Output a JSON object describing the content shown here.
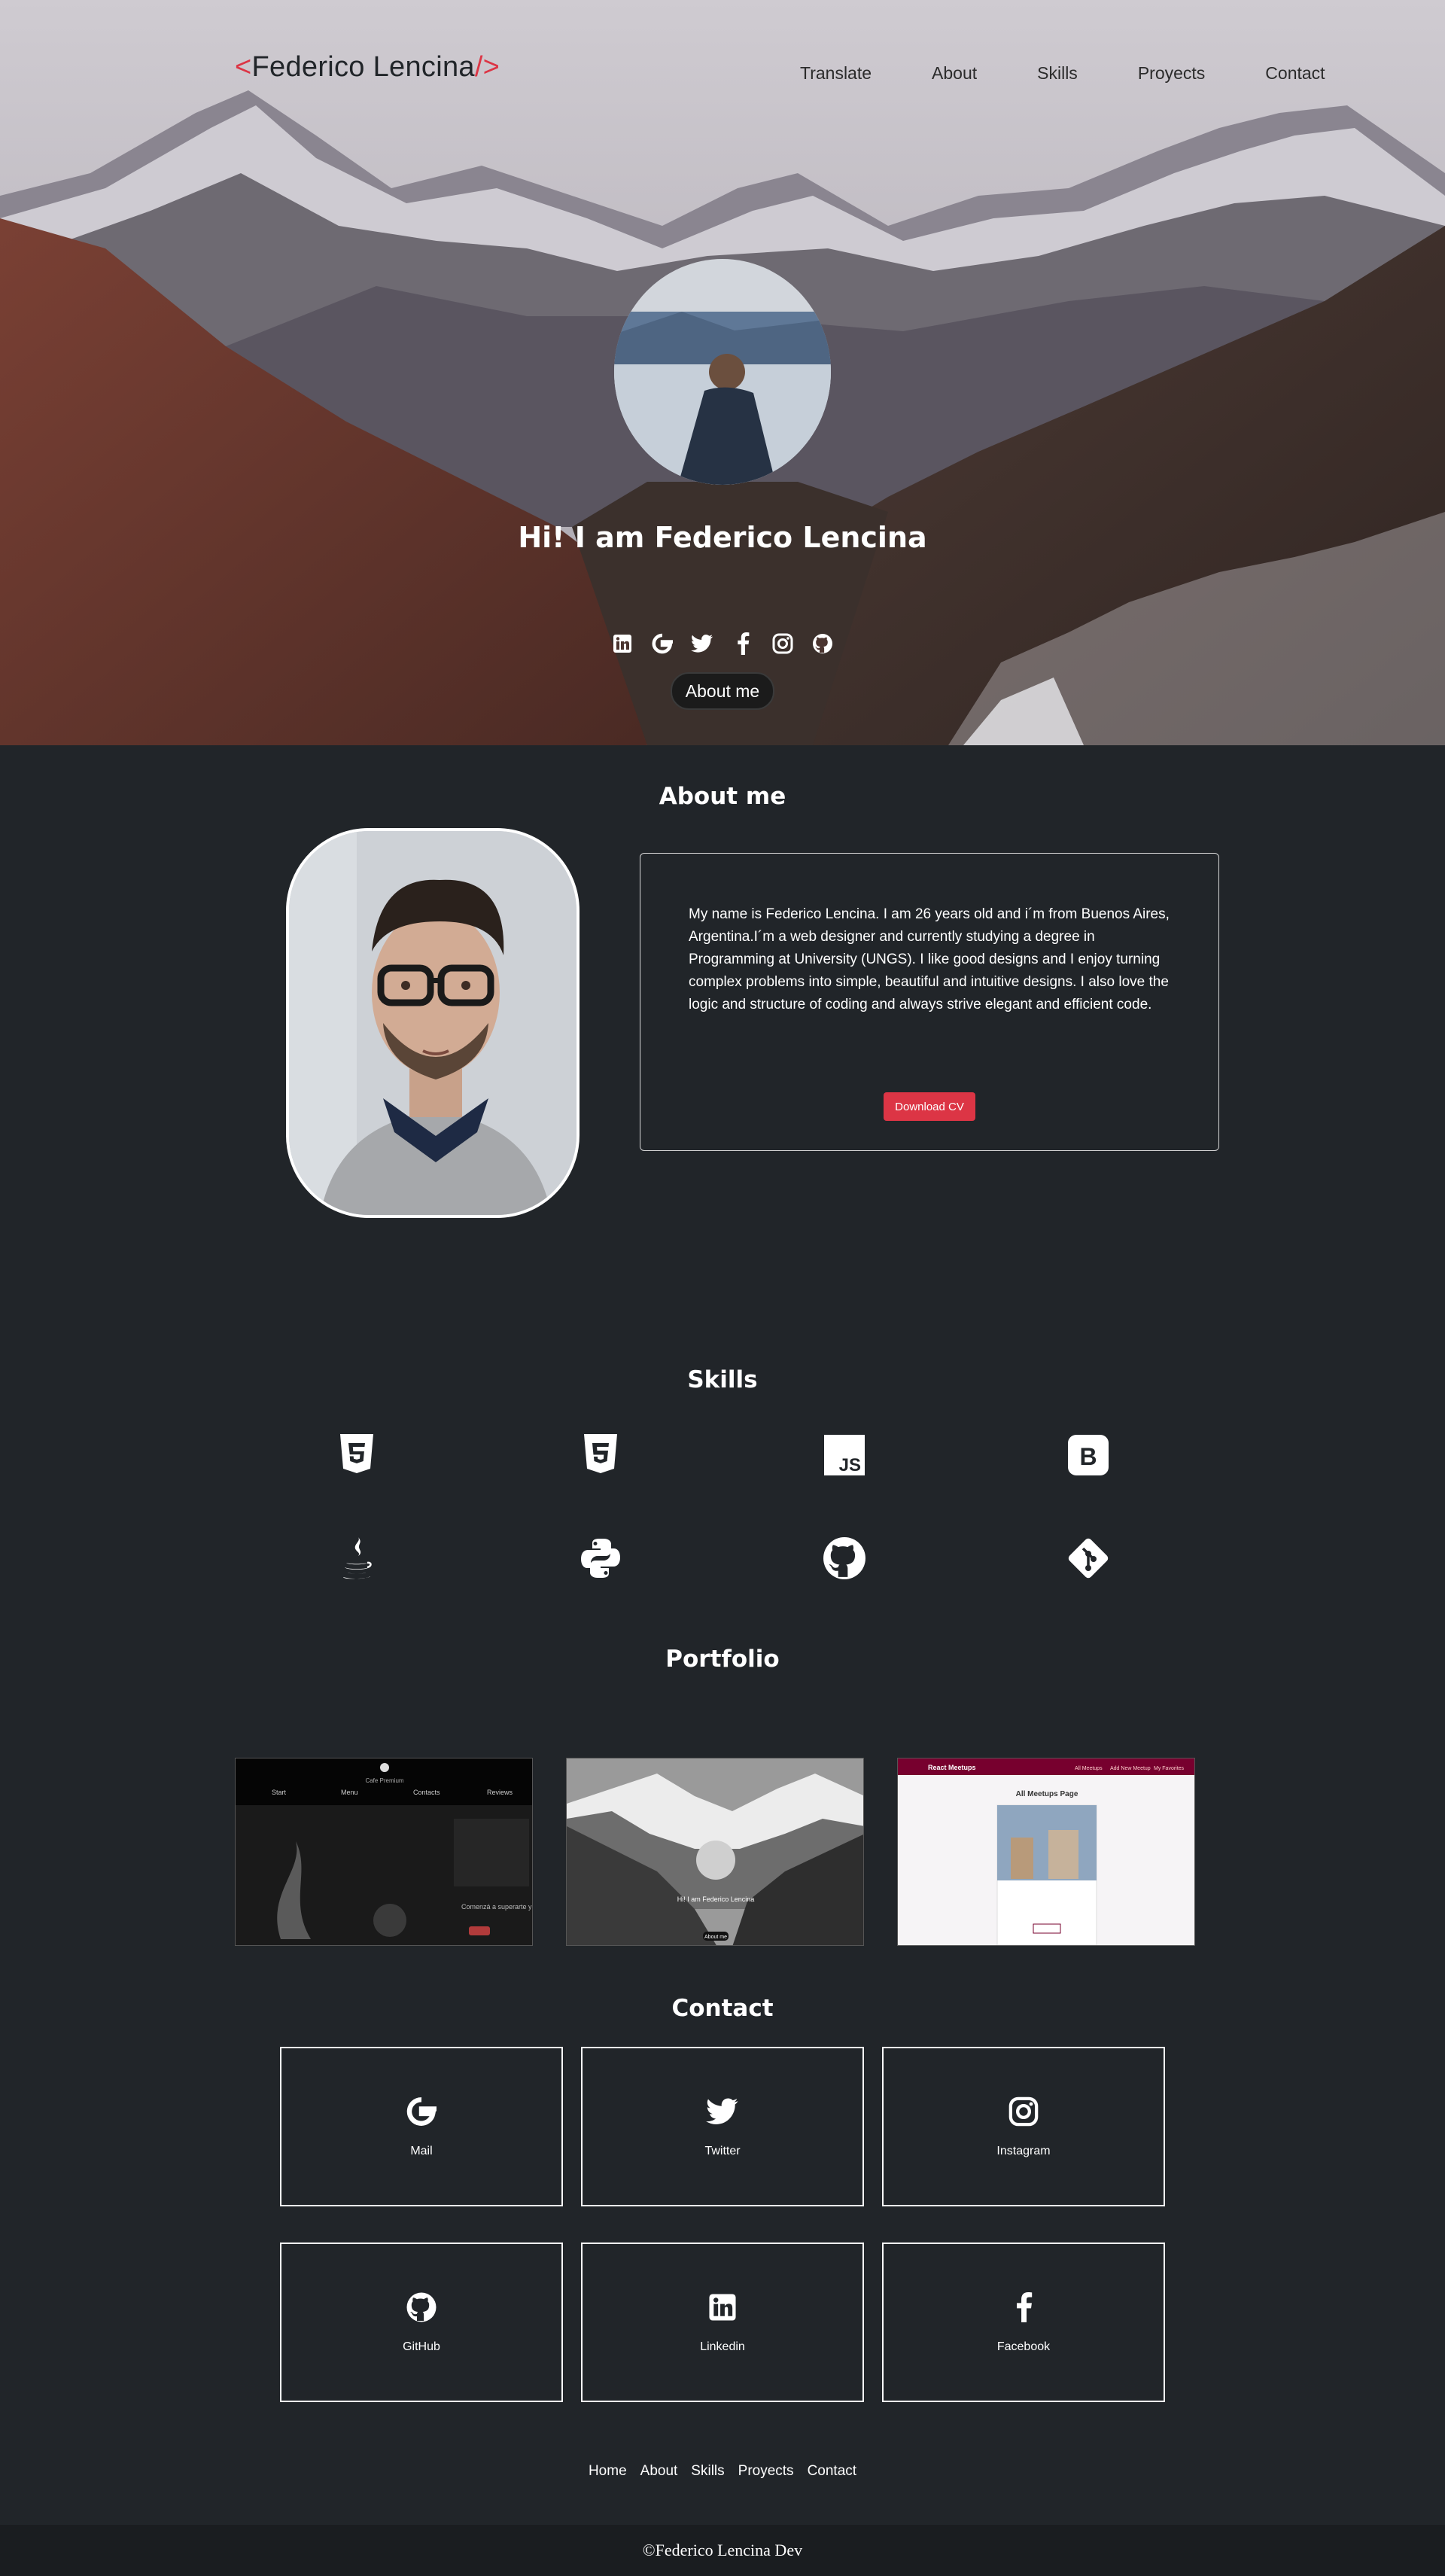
{
  "brand": {
    "open": "<",
    "name": "Federico Lencina",
    "close": "/>"
  },
  "nav": {
    "items": [
      "Translate",
      "About",
      "Skills",
      "Proyects",
      "Contact"
    ]
  },
  "hero": {
    "title": "Hi! I am Federico Lencina",
    "social_icons": [
      "linkedin-icon",
      "google-icon",
      "twitter-icon",
      "facebook-icon",
      "instagram-icon",
      "github-icon"
    ],
    "button_label": "About me"
  },
  "about": {
    "title": "About me",
    "text": "My name is Federico Lencina. I am 26 years old and i´m from Buenos Aires, Argentina.I´m a web designer and currently studying a degree in Programming at University (UNGS). I like good designs and I enjoy turning complex problems into simple, beautiful and intuitive designs. I also love the logic and structure of coding and always strive elegant and efficient code.",
    "cv_button": "Download CV"
  },
  "skills": {
    "title": "Skills",
    "icons": [
      "html5-icon",
      "css3-icon",
      "javascript-icon",
      "bootstrap-icon",
      "java-icon",
      "python-icon",
      "github-icon",
      "git-icon"
    ]
  },
  "portfolio": {
    "title": "Portfolio",
    "projects": [
      {
        "nav": [
          "Start",
          "Menu",
          "Contacts",
          "Reviews"
        ],
        "caption": "Comenzá a superarte y lograr el cambio que siempre buscaste!"
      },
      {
        "caption": "Hi! I am Federico Lencina",
        "button": "About me"
      },
      {
        "header": "React Meetups",
        "links": [
          "All Meetups",
          "Add New Meetup",
          "My Favorites"
        ],
        "heading": "All Meetups Page"
      }
    ]
  },
  "contact": {
    "title": "Contact",
    "cards": [
      {
        "label": "Mail",
        "icon": "google-icon"
      },
      {
        "label": "Twitter",
        "icon": "twitter-icon"
      },
      {
        "label": "Instagram",
        "icon": "instagram-icon"
      },
      {
        "label": "GitHub",
        "icon": "github-icon"
      },
      {
        "label": "Linkedin",
        "icon": "linkedin-icon"
      },
      {
        "label": "Facebook",
        "icon": "facebook-icon"
      }
    ]
  },
  "footer": {
    "links": [
      "Home",
      "About",
      "Skills",
      "Proyects",
      "Contact"
    ],
    "copyright": "©Federico Lencina Dev"
  },
  "colors": {
    "background": "#212529",
    "accent": "#dc3545",
    "footer_bar": "#1a1d20"
  }
}
